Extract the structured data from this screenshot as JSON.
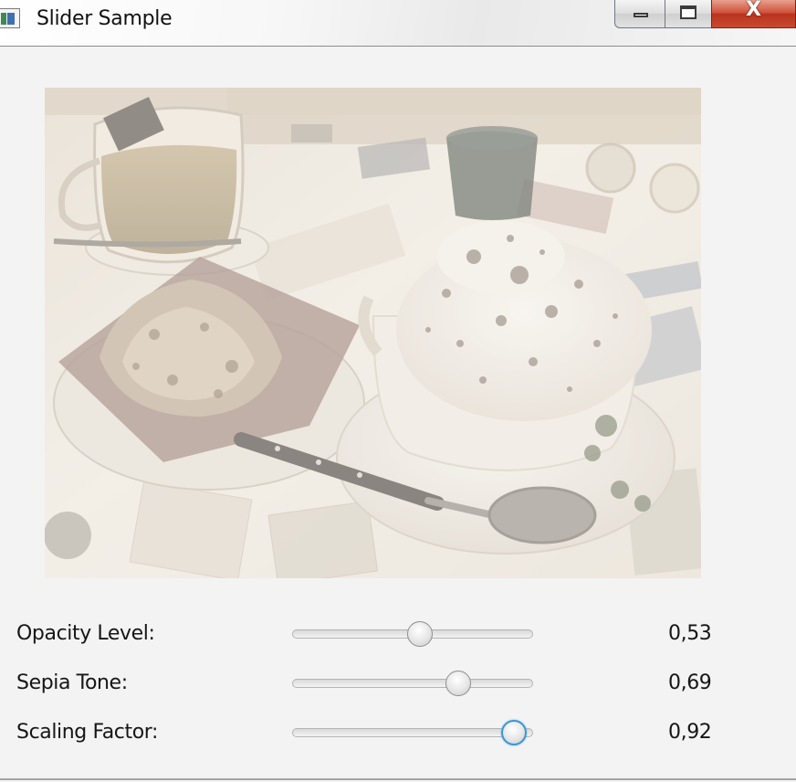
{
  "window": {
    "title": "Slider Sample",
    "controls": {
      "minimize_icon": "minimize-icon",
      "maximize_icon": "maximize-icon",
      "close_label": "X"
    }
  },
  "image": {
    "subject": "cappuccino-with-pastry-and-tea"
  },
  "sliders": [
    {
      "label": "Opacity Level:",
      "value": 0.53,
      "value_text": "0,53",
      "min": 0,
      "max": 1,
      "focused": false
    },
    {
      "label": "Sepia Tone:",
      "value": 0.69,
      "value_text": "0,69",
      "min": 0,
      "max": 1,
      "focused": false
    },
    {
      "label": "Scaling Factor:",
      "value": 0.92,
      "value_text": "0,92",
      "min": 0,
      "max": 1,
      "focused": true
    }
  ],
  "colors": {
    "focus_ring": "#3a95d8",
    "background": "#f3f3f3",
    "close_button": "#c84a30"
  }
}
